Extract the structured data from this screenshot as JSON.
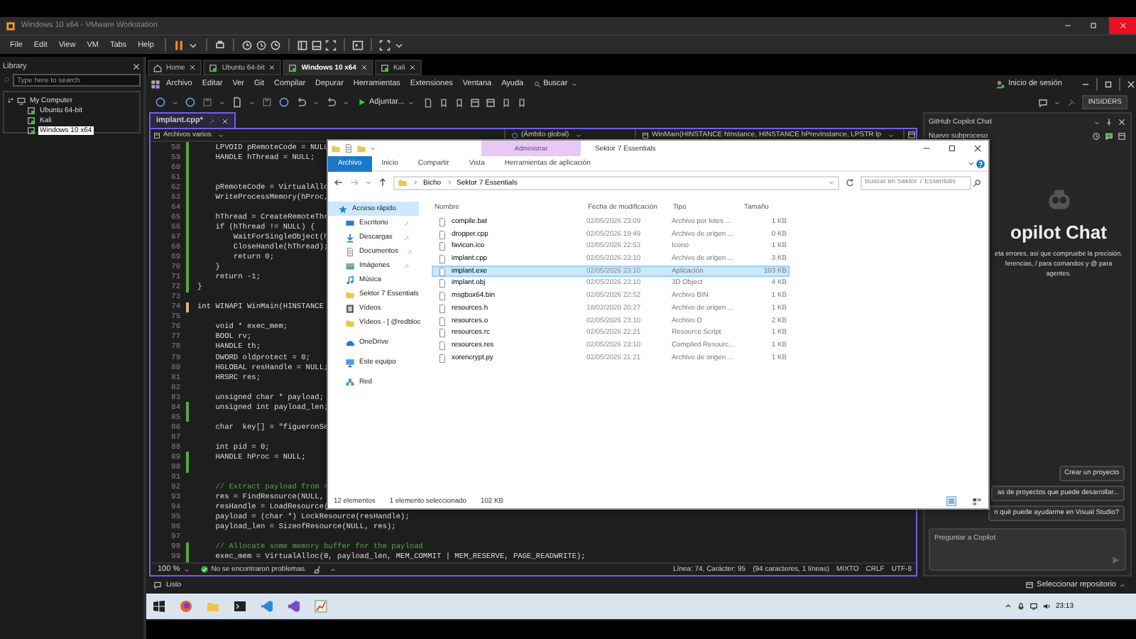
{
  "vmware": {
    "title": "Windows 10 x64 - VMware Workstation",
    "menu": [
      "File",
      "Edit",
      "View",
      "VM",
      "Tabs",
      "Help"
    ],
    "library": {
      "title": "Library",
      "search": {
        "placeholder": "Type here to search"
      },
      "tree": [
        {
          "label": "My Computer",
          "kind": "computer",
          "selected": false,
          "children": [
            {
              "label": "Ubuntu 64-bit",
              "kind": "vm",
              "selected": false
            },
            {
              "label": "Kali",
              "kind": "vm",
              "selected": false
            },
            {
              "label": "Windows 10 x64",
              "kind": "vm",
              "selected": true
            }
          ]
        }
      ]
    },
    "vm_tabs": [
      {
        "label": "Home",
        "kind": "home",
        "selected": false
      },
      {
        "label": "Ubuntu 64-bit",
        "kind": "vm",
        "selected": false
      },
      {
        "label": "Windows 10 x64",
        "kind": "vm",
        "selected": true
      },
      {
        "label": "Kali",
        "kind": "vm",
        "selected": false
      }
    ]
  },
  "vs": {
    "menu": [
      "Archivo",
      "Editar",
      "Ver",
      "Git",
      "Compilar",
      "Depurar",
      "Herramientas",
      "Extensiones",
      "Ventana",
      "Ayuda"
    ],
    "search": "Buscar",
    "sign_in": "Inicio de sesión",
    "attach": "Adjuntar...",
    "channel": "INSIDERS",
    "doc_tabs": [
      {
        "label": "implant.cpp*",
        "selected": true
      }
    ],
    "nav": [
      "Archivos varios",
      "(Ámbito global)",
      "WinMain(HINSTANCE hInstance, HINSTANCE hPrevInstance, LPSTR lp"
    ],
    "code_lines": [
      {
        "number": "58",
        "kind": "code",
        "text": "    LPVOID pRemoteCode = NULL",
        "changed": true,
        "saved": true
      },
      {
        "number": "59",
        "kind": "code",
        "text": "    HANDLE hThread = NULL;",
        "changed": true,
        "saved": true
      },
      {
        "number": "60",
        "changed": true,
        "saved": true
      },
      {
        "number": "61",
        "changed": true,
        "saved": true
      },
      {
        "number": "62",
        "kind": "code",
        "text": "    pRemoteCode = VirtualAllo",
        "changed": true,
        "saved": true
      },
      {
        "number": "63",
        "kind": "code",
        "text": "    WriteProcessMemory(hProc,",
        "changed": true,
        "saved": true
      },
      {
        "number": "64",
        "changed": true,
        "saved": true
      },
      {
        "number": "65",
        "kind": "code",
        "text": "    hThread = CreateRemoteThr",
        "changed": true,
        "saved": true
      },
      {
        "number": "66",
        "kind": "code",
        "text": "    if (hThread != NULL) {",
        "changed": true,
        "saved": true
      },
      {
        "number": "67",
        "kind": "code",
        "text": "        WaitForSingleObject(h",
        "changed": true,
        "saved": true
      },
      {
        "number": "68",
        "kind": "code",
        "text": "        CloseHandle(hThread);",
        "changed": true,
        "saved": true
      },
      {
        "number": "69",
        "kind": "code",
        "text": "        return 0;",
        "changed": true,
        "saved": true
      },
      {
        "number": "70",
        "kind": "code",
        "text": "    }",
        "changed": true,
        "saved": true
      },
      {
        "number": "71",
        "kind": "code",
        "text": "    return -1;",
        "changed": true,
        "saved": true
      },
      {
        "number": "72",
        "kind": "code",
        "text": "}",
        "changed": true,
        "saved": true
      },
      {
        "number": "73",
        "changed": false
      },
      {
        "number": "74",
        "kind": "code",
        "text": "int WINAPI WinMain(HINSTANCE",
        "changed": true,
        "saved": false
      },
      {
        "number": "75",
        "changed": false
      },
      {
        "number": "76",
        "kind": "code",
        "text": "    void * exec_mem;",
        "changed": false
      },
      {
        "number": "77",
        "kind": "code",
        "text": "    BOOL rv;",
        "changed": false
      },
      {
        "number": "78",
        "kind": "code",
        "text": "    HANDLE th;",
        "changed": false
      },
      {
        "number": "79",
        "kind": "code",
        "text": "    DWORD oldprotect = 0;",
        "changed": false
      },
      {
        "number": "80",
        "kind": "code",
        "text": "    HGLOBAL resHandle = NULL;",
        "changed": false
      },
      {
        "number": "81",
        "kind": "code",
        "text": "    HRSRC res;",
        "changed": false
      },
      {
        "number": "82",
        "changed": false
      },
      {
        "number": "83",
        "kind": "code",
        "text": "    unsigned char * payload;",
        "changed": false
      },
      {
        "number": "84",
        "kind": "code",
        "text": "    unsigned int payload_len;",
        "changed": true,
        "saved": true
      },
      {
        "number": "85",
        "changed": true,
        "saved": true
      },
      {
        "number": "86",
        "kind": "code",
        "text": "    char  key[] = \"figueronSe",
        "changed": false
      },
      {
        "number": "87",
        "changed": false
      },
      {
        "number": "88",
        "kind": "code",
        "text": "    int pid = 0;",
        "changed": false
      },
      {
        "number": "89",
        "kind": "code",
        "text": "    HANDLE hProc = NULL;",
        "changed": true,
        "saved": true
      },
      {
        "number": "90",
        "changed": true,
        "saved": true
      },
      {
        "number": "91",
        "changed": false
      },
      {
        "number": "92",
        "kind": "comment",
        "text": "    // Extract payload from r",
        "changed": false
      },
      {
        "number": "93",
        "kind": "code",
        "text": "    res = FindResource(NULL,",
        "changed": false
      },
      {
        "number": "94",
        "kind": "code",
        "text": "    resHandle = LoadResource(",
        "changed": false
      },
      {
        "number": "95",
        "kind": "code",
        "text": "    payload = (char *) LockResource(resHandle);",
        "changed": false
      },
      {
        "number": "96",
        "kind": "code",
        "text": "    payload_len = SizeofResource(NULL, res);",
        "changed": false
      },
      {
        "number": "97",
        "changed": false
      },
      {
        "number": "98",
        "kind": "comment",
        "text": "    // Allocate some memory buffer for the payload",
        "changed": true,
        "saved": true
      },
      {
        "number": "99",
        "kind": "code",
        "text": "    exec_mem = VirtualAlloc(0, payload_len, MEM_COMMIT | MEM_RESERVE, PAGE_READWRITE);",
        "changed": true,
        "saved": true
      }
    ],
    "editor_status": {
      "zoom": "100 %",
      "problems": "No se encontraron problemas.",
      "position": "Línea: 74, Carácter: 95",
      "selection": "(94 caracteres, 1 líneas)",
      "indent": "MIXTO",
      "line_endings": "CRLF",
      "encoding": "UTF-8"
    },
    "copilot": {
      "title": "GitHub Copilot Chat",
      "thread": "Nuevo subproceso",
      "heading": "opilot Chat",
      "notes": [
        "eta errores, así que compruebe la precisión.",
        "ferencias, / para comandos y @ para",
        "agentes."
      ],
      "suggestions": [
        "Crear un proyecto",
        "as de proyectos que puede desarrollar...",
        "n qué puede ayudarme en Visual Studio?"
      ],
      "input": {
        "placeholder": "Preguntar a Copilot"
      }
    },
    "status": "Listo",
    "repo": "Seleccionar repositorio"
  },
  "explorer": {
    "title": "Sektor 7 Essentials",
    "context_tab": "Administrar",
    "ribbon_tabs": [
      {
        "label": "Archivo",
        "selected": true
      },
      {
        "label": "Inicio",
        "selected": false
      },
      {
        "label": "Compartir",
        "selected": false
      },
      {
        "label": "Vista",
        "selected": false
      },
      {
        "label": "Herramientas de aplicación",
        "selected": false
      }
    ],
    "path": [
      "Bicho",
      "Sektor 7 Essentials"
    ],
    "search": {
      "placeholder": "Buscar en Sektor 7 Essentials"
    },
    "nav": [
      {
        "label": "Acceso rápido",
        "kind": "quick",
        "pinned": false,
        "selected": true
      },
      {
        "label": "Escritorio",
        "kind": "desktop",
        "pinned": true,
        "selected": false
      },
      {
        "label": "Descargas",
        "kind": "downloads",
        "pinned": true,
        "selected": false
      },
      {
        "label": "Documentos",
        "kind": "documents",
        "pinned": true,
        "selected": false
      },
      {
        "label": "Imágenes",
        "kind": "images",
        "pinned": true,
        "selected": false
      },
      {
        "label": "Música",
        "kind": "music",
        "pinned": false,
        "selected": false
      },
      {
        "label": "Sektor 7 Essentials",
        "kind": "folder",
        "pinned": false,
        "selected": false
      },
      {
        "label": "Vídeos",
        "kind": "videos",
        "pinned": false,
        "selected": false
      },
      {
        "label": "Vídeos - [ @redbloc",
        "kind": "folder",
        "pinned": false,
        "selected": false
      },
      {
        "label": "OneDrive",
        "kind": "onedrive",
        "pinned": false,
        "selected": false
      },
      {
        "label": "Este equipo",
        "kind": "pc",
        "pinned": false,
        "selected": false
      },
      {
        "label": "Red",
        "kind": "network",
        "pinned": false,
        "selected": false
      }
    ],
    "columns": [
      "Nombre",
      "Fecha de modificación",
      "Tipo",
      "Tamaño"
    ],
    "files": [
      {
        "name": "compile.bat",
        "date": "02/05/2026 23:09",
        "type": "Archivo por lotes ...",
        "size": "1 KB",
        "selected": false
      },
      {
        "name": "dropper.cpp",
        "date": "02/05/2026 19:49",
        "type": "Archivo de origen ...",
        "size": "0 KB",
        "selected": false
      },
      {
        "name": "favicon.ico",
        "date": "02/05/2026 22:53",
        "type": "Icono",
        "size": "1 KB",
        "selected": false
      },
      {
        "name": "implant.cpp",
        "date": "02/05/2026 23:10",
        "type": "Archivo de origen ...",
        "size": "3 KB",
        "selected": false
      },
      {
        "name": "implant.exe",
        "date": "02/05/2026 23:10",
        "type": "Aplicación",
        "size": "103 KB",
        "selected": true
      },
      {
        "name": "implant.obj",
        "date": "02/05/2026 23:10",
        "type": "3D Object",
        "size": "4 KB",
        "selected": false
      },
      {
        "name": "msgbox64.bin",
        "date": "02/05/2026 22:52",
        "type": "Archivo BIN",
        "size": "1 KB",
        "selected": false
      },
      {
        "name": "resources.h",
        "date": "18/02/2020 20:27",
        "type": "Archivo de origen ...",
        "size": "1 KB",
        "selected": false
      },
      {
        "name": "resources.o",
        "date": "02/05/2026 23:10",
        "type": "Archivo O",
        "size": "2 KB",
        "selected": false
      },
      {
        "name": "resources.rc",
        "date": "02/05/2026 22:21",
        "type": "Resource Script",
        "size": "1 KB",
        "selected": false
      },
      {
        "name": "resources.res",
        "date": "02/05/2026 23:10",
        "type": "Compiled Resourc...",
        "size": "1 KB",
        "selected": false
      },
      {
        "name": "xorencrypt.py",
        "date": "02/05/2026 21:21",
        "type": "Archivo de origen ...",
        "size": "1 KB",
        "selected": false
      }
    ],
    "status": {
      "count": "12 elementos",
      "selection": "1 elemento seleccionado",
      "size": "102 KB"
    }
  },
  "taskbar": {
    "apps": [
      {
        "kind": "start"
      },
      {
        "kind": "browser"
      },
      {
        "kind": "folder"
      },
      {
        "kind": "terminal"
      },
      {
        "kind": "code"
      },
      {
        "kind": "studio"
      },
      {
        "kind": "chart"
      }
    ],
    "clock": "23:13"
  }
}
